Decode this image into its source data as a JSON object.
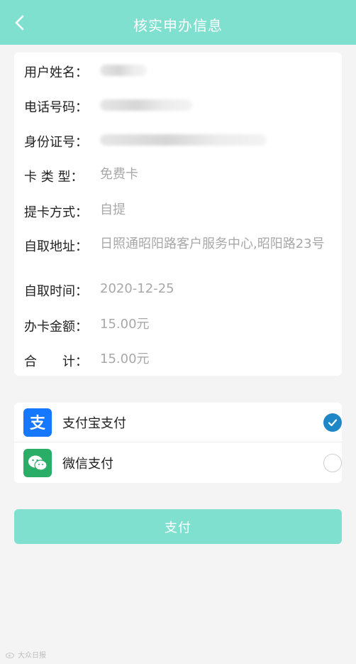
{
  "header": {
    "title": "核实申办信息",
    "back_icon": "chevron-left-icon",
    "background": "#7fe0cf"
  },
  "info": {
    "name_label": "用户姓名：",
    "phone_label": "电话号码：",
    "id_label": "身份证号：",
    "card_type_label": "卡 类 型：",
    "card_type_value": "免费卡",
    "pickup_method_label": "提卡方式：",
    "pickup_method_value": "自提",
    "pickup_address_label": "自取地址：",
    "pickup_address_value": "日照通昭阳路客户服务中心,昭阳路23号",
    "pickup_time_label": "自取时间：",
    "pickup_time_value": "2020-12-25",
    "fee_label": "办卡金额：",
    "fee_value": "15.00元",
    "total_label": "合　　计：",
    "total_value": "15.00元"
  },
  "payment": {
    "alipay_label": "支付宝支付",
    "alipay_icon": "alipay-icon",
    "alipay_selected": true,
    "wechat_label": "微信支付",
    "wechat_icon": "wechat-icon",
    "wechat_selected": false
  },
  "pay_button_label": "支付",
  "watermark": "大众日报",
  "colors": {
    "accent": "#7fe0cf",
    "check": "#1f87c8"
  }
}
